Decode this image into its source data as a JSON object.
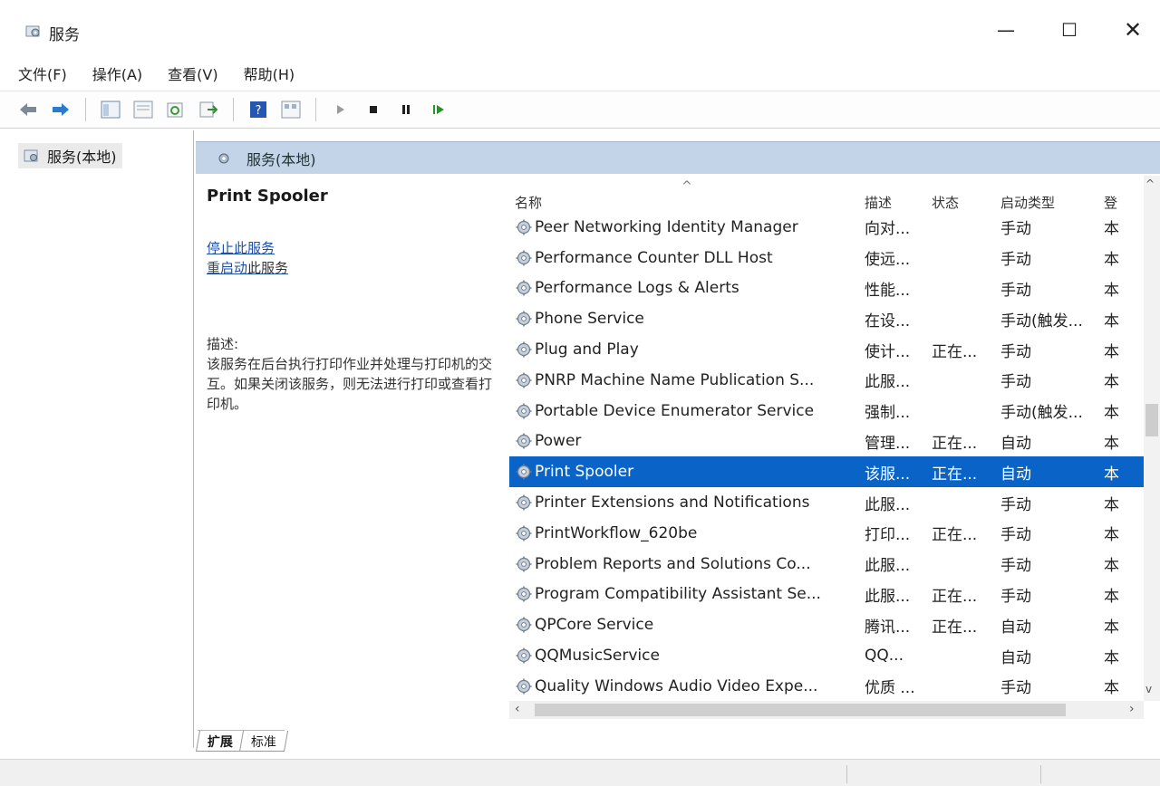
{
  "window": {
    "title": "服务",
    "minimize": "—",
    "maximize": "☐",
    "close": "✕"
  },
  "menu": [
    "文件(F)",
    "操作(A)",
    "查看(V)",
    "帮助(H)"
  ],
  "toolbar": [
    "back-arrow-icon",
    "forward-arrow-icon",
    "show-hide-tree-icon",
    "properties-icon",
    "refresh-icon",
    "export-icon",
    "help-icon",
    "view-icon",
    "start-service-icon",
    "stop-service-icon",
    "pause-service-icon",
    "restart-service-icon"
  ],
  "tree": {
    "root": "服务(本地)"
  },
  "pane": {
    "header": "服务(本地)",
    "selected_name": "Print Spooler",
    "stop_link": "停止此服务",
    "restart_link_a": "重启动",
    "restart_link_b": "此服务",
    "desc_label": "描述:",
    "desc_text": "该服务在后台执行打印作业并处理与打印机的交互。如果关闭该服务，则无法进行打印或查看打印机。"
  },
  "columns": {
    "name": "名称",
    "desc": "描述",
    "status": "状态",
    "startup": "启动类型",
    "logon": "登"
  },
  "services": [
    {
      "name": "Peer Networking Identity Manager",
      "desc": "向对...",
      "status": "",
      "startup": "手动",
      "logon": "本"
    },
    {
      "name": "Performance Counter DLL Host",
      "desc": "使远...",
      "status": "",
      "startup": "手动",
      "logon": "本"
    },
    {
      "name": "Performance Logs & Alerts",
      "desc": "性能...",
      "status": "",
      "startup": "手动",
      "logon": "本"
    },
    {
      "name": "Phone Service",
      "desc": "在设...",
      "status": "",
      "startup": "手动(触发...",
      "logon": "本"
    },
    {
      "name": "Plug and Play",
      "desc": "使计...",
      "status": "正在...",
      "startup": "手动",
      "logon": "本"
    },
    {
      "name": "PNRP Machine Name Publication S...",
      "desc": "此服...",
      "status": "",
      "startup": "手动",
      "logon": "本"
    },
    {
      "name": "Portable Device Enumerator Service",
      "desc": "强制...",
      "status": "",
      "startup": "手动(触发...",
      "logon": "本"
    },
    {
      "name": "Power",
      "desc": "管理...",
      "status": "正在...",
      "startup": "自动",
      "logon": "本"
    },
    {
      "name": "Print Spooler",
      "desc": "该服...",
      "status": "正在...",
      "startup": "自动",
      "logon": "本"
    },
    {
      "name": "Printer Extensions and Notifications",
      "desc": "此服...",
      "status": "",
      "startup": "手动",
      "logon": "本"
    },
    {
      "name": "PrintWorkflow_620be",
      "desc": "打印...",
      "status": "正在...",
      "startup": "手动",
      "logon": "本"
    },
    {
      "name": "Problem Reports and Solutions Co...",
      "desc": "此服...",
      "status": "",
      "startup": "手动",
      "logon": "本"
    },
    {
      "name": "Program Compatibility Assistant Se...",
      "desc": "此服...",
      "status": "正在...",
      "startup": "手动",
      "logon": "本"
    },
    {
      "name": "QPCore Service",
      "desc": "腾讯...",
      "status": "正在...",
      "startup": "自动",
      "logon": "本"
    },
    {
      "name": "QQMusicService",
      "desc": "QQ...",
      "status": "",
      "startup": "自动",
      "logon": "本"
    },
    {
      "name": "Quality Windows Audio Video Expe...",
      "desc": "优质 ...",
      "status": "",
      "startup": "手动",
      "logon": "本"
    }
  ],
  "selected_index": 8,
  "scroll": {
    "left": "‹",
    "right": "›",
    "up": "^",
    "down": "v"
  },
  "tabs": [
    "扩展",
    "标准"
  ],
  "colors": {
    "selection": "#0a64c8",
    "header": "#c3d3e8",
    "link": "#1a4fa8"
  }
}
